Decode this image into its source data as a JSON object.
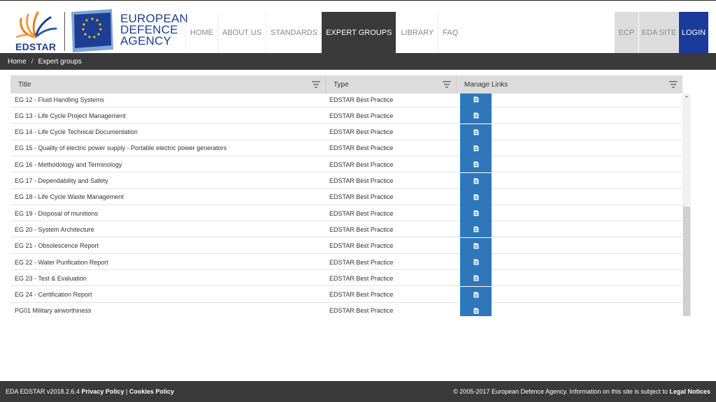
{
  "brand": {
    "edstar_label": "EDSTAR",
    "eda_line1": "EUROPEAN",
    "eda_line2": "DEFENCE",
    "eda_line3": "AGENCY",
    "primary_color": "#1c3f94",
    "accent_color": "#f07c1f"
  },
  "nav": {
    "items": [
      {
        "label": "HOME"
      },
      {
        "label": "ABOUT US"
      },
      {
        "label": "STANDARDS"
      },
      {
        "label": "EXPERT GROUPS"
      },
      {
        "label": "LIBRARY"
      },
      {
        "label": "FAQ"
      }
    ],
    "active_index": 3,
    "right": {
      "ecp": "ECP",
      "eda_site": "EDA SITE",
      "login": "LOGIN"
    }
  },
  "breadcrumb": {
    "home": "Home",
    "separator": "/",
    "current": "Expert groups"
  },
  "grid": {
    "columns": [
      {
        "label": "Title"
      },
      {
        "label": "Type"
      },
      {
        "label": "Manage Links"
      }
    ],
    "rows": [
      {
        "title": "EG 12 - Fluid Handling Systems",
        "type": "EDSTAR Best Practice"
      },
      {
        "title": "EG 13 - Life Cycle Project Management",
        "type": "EDSTAR Best Practice"
      },
      {
        "title": "EG 14 - Life Cycle Technical Documentation",
        "type": "EDSTAR Best Practice"
      },
      {
        "title": "EG 15 - Quality of electric power supply - Portable electric power generators",
        "type": "EDSTAR Best Practice"
      },
      {
        "title": "EG 16 - Methodology and Terminology",
        "type": "EDSTAR Best Practice"
      },
      {
        "title": "EG 17 - Dependability and Safety",
        "type": "EDSTAR Best Practice"
      },
      {
        "title": "EG 18 - Life Cycle Waste Management",
        "type": "EDSTAR Best Practice"
      },
      {
        "title": "EG 19 - Disposal of munitions",
        "type": "EDSTAR Best Practice"
      },
      {
        "title": "EG 20 - System Architecture",
        "type": "EDSTAR Best Practice"
      },
      {
        "title": "EG 21 - Obsolescence Report",
        "type": "EDSTAR Best Practice"
      },
      {
        "title": "EG 22 - Water Purification Report",
        "type": "EDSTAR Best Practice"
      },
      {
        "title": "EG 23 - Test & Evaluation",
        "type": "EDSTAR Best Practice"
      },
      {
        "title": "EG 24 - Certification Report",
        "type": "EDSTAR Best Practice"
      },
      {
        "title": "PG01 Military airworthiness",
        "type": "EDSTAR Best Practice"
      }
    ],
    "link_button_icon": "document-icon",
    "link_button_color": "#2e77bb"
  },
  "footer": {
    "version": "EDA EDSTAR v2018.2.6.4",
    "privacy": "Privacy Policy",
    "divider": "|",
    "cookies": "Cookies Policy",
    "copyright": "© 2005-2017 European Defence Agency. Information on this site is subject to",
    "legal": "Legal Notices"
  }
}
